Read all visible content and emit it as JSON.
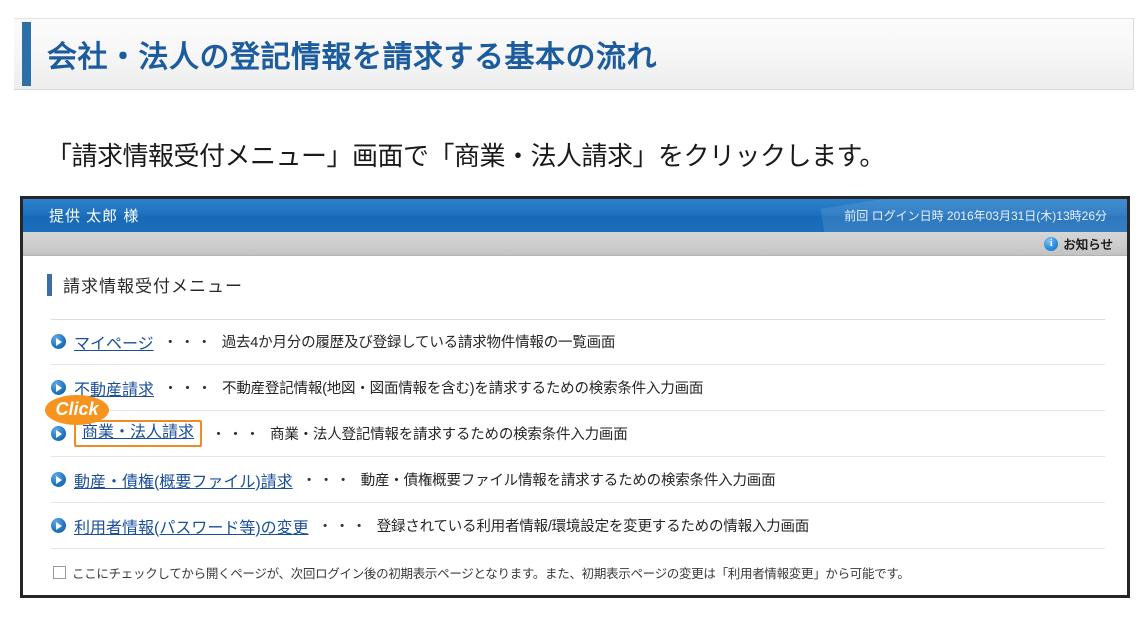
{
  "page": {
    "heading": "会社・法人の登記情報を請求する基本の流れ",
    "instruction": "「請求情報受付メニュー」画面で「商業・法人請求」をクリックします。",
    "accent_color": "#2f6fa8",
    "heading_text_color": "#1c5c9e"
  },
  "app": {
    "topbar": {
      "user_label": "提供 太郎 様",
      "login_datetime": "前回 ログイン日時 2016年03月31日(木)13時26分",
      "background_color": "#1f72c0"
    },
    "subbar": {
      "notice_label": "お知らせ",
      "info_icon": "info-icon",
      "info_icon_glyph": "i"
    },
    "menu": {
      "title": "請求情報受付メニュー",
      "dots": "・・・",
      "items": [
        {
          "icon": "play-circle-icon",
          "link": "マイページ",
          "description": "過去4か月分の履歴及び登録している請求物件情報の一覧画面",
          "highlighted": false
        },
        {
          "icon": "play-circle-icon",
          "link": "不動産請求",
          "description": "不動産登記情報(地図・図面情報を含む)を請求するための検索条件入力画面",
          "highlighted": false
        },
        {
          "icon": "play-circle-icon",
          "link": "商業・法人請求",
          "description": "商業・法人登記情報を請求するための検索条件入力画面",
          "highlighted": true,
          "badge": "Click",
          "highlight_color": "#f08a24",
          "badge_color": "#f79420"
        },
        {
          "icon": "play-circle-icon",
          "link": "動産・債権(概要ファイル)請求",
          "description": "動産・債権概要ファイル情報を請求するための検索条件入力画面",
          "highlighted": false
        },
        {
          "icon": "play-circle-icon",
          "link": "利用者情報(パスワード等)の変更",
          "description": "登録されている利用者情報/環境設定を変更するための情報入力画面",
          "highlighted": false
        }
      ]
    },
    "footer": {
      "checkbox_checked": false,
      "note": "ここにチェックしてから開くページが、次回ログイン後の初期表示ページとなります。また、初期表示ページの変更は「利用者情報変更」から可能です。"
    }
  }
}
